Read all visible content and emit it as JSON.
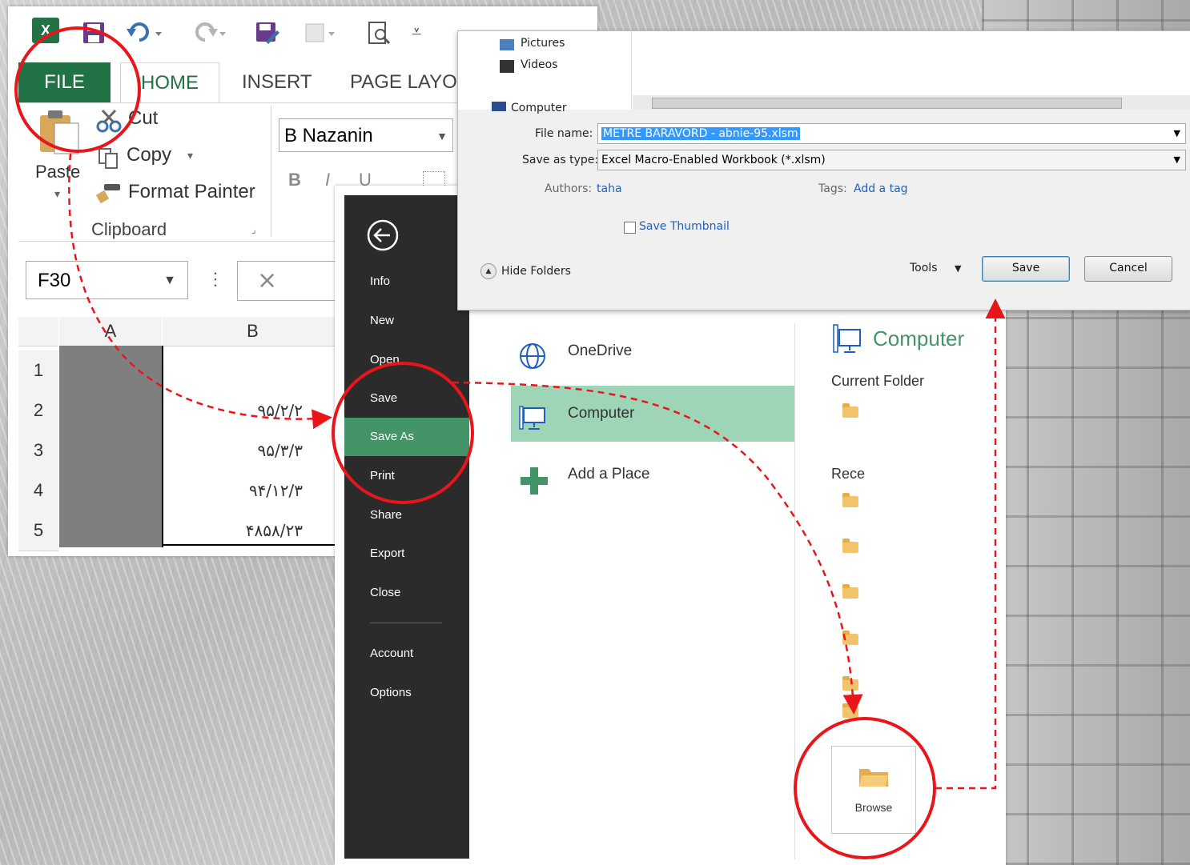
{
  "excel": {
    "tabs": {
      "file": "FILE",
      "home": "HOME",
      "insert": "INSERT",
      "page_layout": "PAGE LAYOU"
    },
    "clipboard": {
      "paste": "Paste",
      "cut": "Cut",
      "copy": "Copy",
      "format_painter": "Format Painter",
      "group": "Clipboard"
    },
    "font": {
      "name": "B Nazanin",
      "bold": "B",
      "italic": "I",
      "underline": "U"
    },
    "name_box": "F30",
    "columns": [
      "A",
      "B"
    ],
    "rows": [
      "1",
      "2",
      "3",
      "4",
      "5"
    ],
    "cells_b": [
      "",
      "۹۵/۲/۲",
      "۹۵/۳/۳",
      "۹۴/۱۲/۳",
      "۴۸۵۸/۲۳"
    ],
    "fx_cancel": "×",
    "fx_dots": "⋮"
  },
  "backstage": {
    "nav": [
      "Info",
      "New",
      "Open",
      "Save",
      "Save As",
      "Print",
      "Share",
      "Export",
      "Close",
      "Account",
      "Options"
    ],
    "active": "Save As",
    "places": [
      "OneDrive",
      "Computer",
      "Add a Place"
    ],
    "right_title": "Computer",
    "current_folder": "Current Folder",
    "recent": "Rece",
    "browse": "Browse"
  },
  "save_dialog": {
    "tree": [
      "Pictures",
      "Videos",
      "Computer"
    ],
    "file_name_label": "File name:",
    "file_name_value": "METRE BARAVORD - abnie-95.xlsm",
    "save_type_label": "Save as type:",
    "save_type_value": "Excel Macro-Enabled Workbook (*.xlsm)",
    "authors_label": "Authors:",
    "authors_value": "taha",
    "tags_label": "Tags:",
    "tags_value": "Add a tag",
    "save_thumbnail": "Save Thumbnail",
    "hide_folders": "Hide Folders",
    "tools": "Tools",
    "save": "Save",
    "cancel": "Cancel"
  },
  "colors": {
    "excel_green": "#217346",
    "annotation_red": "#e8161b",
    "nav_dark": "#2b2b2b",
    "nav_active": "#439467",
    "place_selected": "#9fd5b7"
  },
  "icons": [
    "excel-logo-icon",
    "save-icon",
    "undo-icon",
    "redo-icon",
    "save-as-icon",
    "print-preview-icon",
    "back-arrow-icon",
    "globe-icon",
    "computer-icon",
    "plus-icon",
    "folder-icon"
  ]
}
